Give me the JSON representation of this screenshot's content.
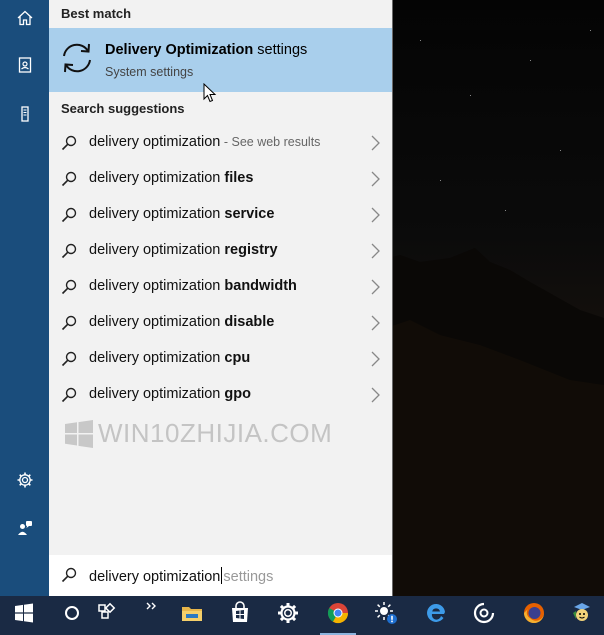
{
  "best_match": {
    "header": "Best match",
    "title_bold": "Delivery Optimization",
    "title_rest": " settings",
    "subtitle": "System settings"
  },
  "suggestions": {
    "header": "Search suggestions",
    "items": [
      {
        "prefix": "delivery optimization",
        "bold": "",
        "web": " - See web results"
      },
      {
        "prefix": "delivery optimization ",
        "bold": "files",
        "web": ""
      },
      {
        "prefix": "delivery optimization ",
        "bold": "service",
        "web": ""
      },
      {
        "prefix": "delivery optimization ",
        "bold": "registry",
        "web": ""
      },
      {
        "prefix": "delivery optimization ",
        "bold": "bandwidth",
        "web": ""
      },
      {
        "prefix": "delivery optimization ",
        "bold": "disable",
        "web": ""
      },
      {
        "prefix": "delivery optimization ",
        "bold": "cpu",
        "web": ""
      },
      {
        "prefix": "delivery optimization ",
        "bold": "gpo",
        "web": ""
      }
    ]
  },
  "watermark": "WIN10ZHIJIA.COM",
  "search": {
    "typed": "delivery optimization",
    "completion": "settings"
  },
  "left_rail": {
    "icons": [
      "home-icon",
      "notebook-icon",
      "device-icon",
      "settings-gear-icon",
      "feedback-icon"
    ]
  },
  "taskbar": {
    "icons": [
      "windows-start-icon",
      "cortana-circle-icon",
      "task-view-icon",
      "overflow-icon",
      "file-explorer-icon",
      "store-icon",
      "settings-icon",
      "chrome-icon",
      "weather-alert-icon",
      "edge-icon",
      "groove-icon",
      "firefox-icon",
      "mascot-app-icon"
    ]
  },
  "colors": {
    "rail": "#1a4d7c",
    "highlight": "#a9cfec",
    "panel": "#f2f2f2",
    "taskbar": "#1a2a44"
  }
}
